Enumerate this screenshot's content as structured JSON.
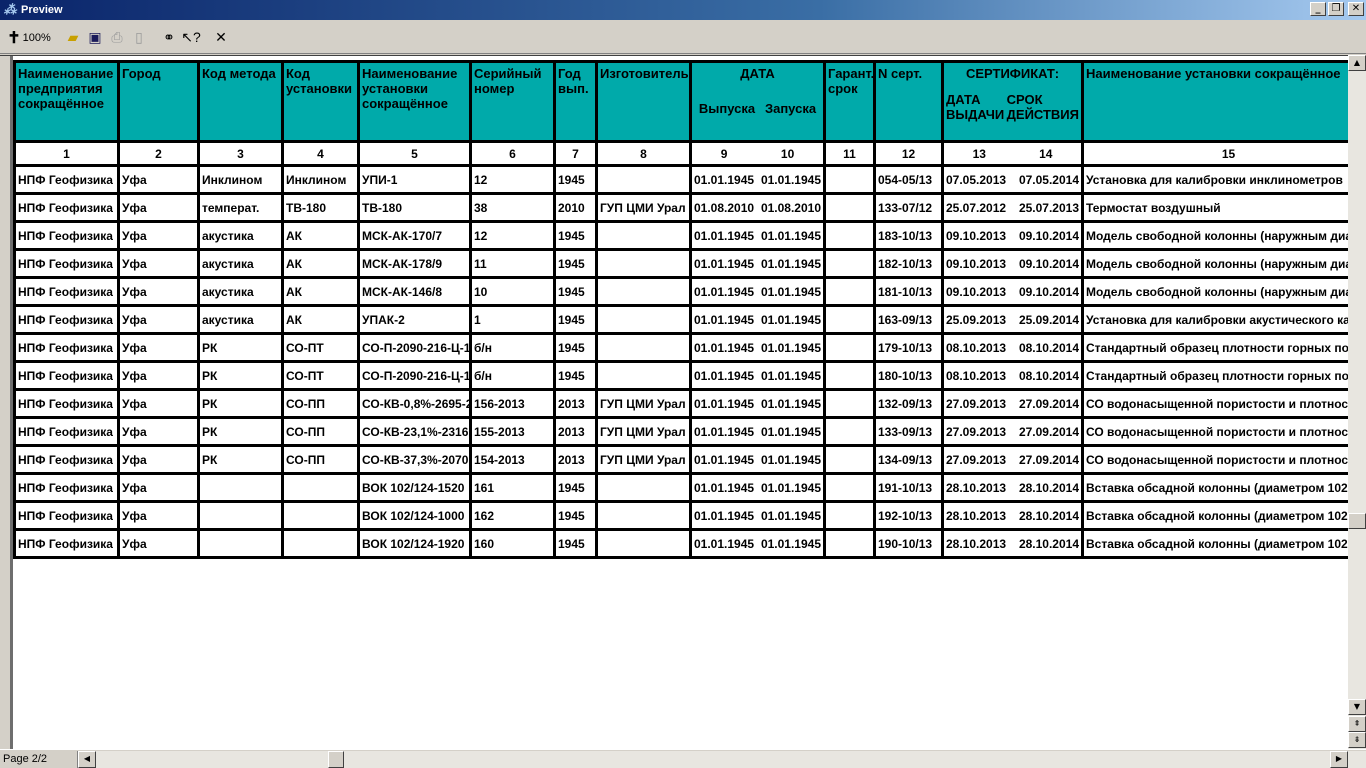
{
  "window": {
    "title": "Preview",
    "minimize_glyph": "_",
    "restore_glyph": "❐",
    "close_glyph": "✕"
  },
  "toolbar": {
    "zoom_label": "100%",
    "buttons": [
      "zoom-icon",
      "open-icon",
      "save-icon",
      "print-icon",
      "page-setup-icon",
      "find-icon",
      "help-icon",
      "close-icon"
    ]
  },
  "table": {
    "headers": {
      "c1": "Наименование предприятия сокращённое",
      "c2": "Город",
      "c3": "Код метода",
      "c4": "Код установки",
      "c5": "Наименование установки сокращённое",
      "c6": "Серийный номер",
      "c7": "Год вып.",
      "c8": "Изготовитель",
      "c9_10": "ДАТА",
      "c9": "Выпуска",
      "c10": "Запуска",
      "c11": "Гарант. срок",
      "c12": "N серт.",
      "c13_14": "СЕРТИФИКАТ:",
      "c13": "ДАТА ВЫДАЧИ",
      "c14": "СРОК ДЕЙСТВИЯ",
      "c15": "Наименование установки сокращённое"
    },
    "numbers": [
      "1",
      "2",
      "3",
      "4",
      "5",
      "6",
      "7",
      "8",
      "9",
      "10",
      "11",
      "12",
      "13",
      "14",
      "15"
    ],
    "rows": [
      [
        "НПФ Геофизика",
        "Уфа",
        "Инклином",
        "Инклином",
        "УПИ-1",
        "12",
        "1945",
        "",
        "01.01.1945",
        "01.01.1945",
        "",
        "054-05/13",
        "07.05.2013",
        "07.05.2014",
        "Установка для калибровки инклинометров"
      ],
      [
        "НПФ Геофизика",
        "Уфа",
        "температ.",
        "ТВ-180",
        "ТВ-180",
        "38",
        "2010",
        "ГУП ЦМИ Урал",
        "01.08.2010",
        "01.08.2010",
        "",
        "133-07/12",
        "25.07.2012",
        "25.07.2013",
        "Термостат воздушный"
      ],
      [
        "НПФ Геофизика",
        "Уфа",
        "акустика",
        "АК",
        "МСК-АК-170/7",
        "12",
        "1945",
        "",
        "01.01.1945",
        "01.01.1945",
        "",
        "183-10/13",
        "09.10.2013",
        "09.10.2014",
        "Модель свободной колонны (наружным диа"
      ],
      [
        "НПФ Геофизика",
        "Уфа",
        "акустика",
        "АК",
        "МСК-АК-178/9",
        "11",
        "1945",
        "",
        "01.01.1945",
        "01.01.1945",
        "",
        "182-10/13",
        "09.10.2013",
        "09.10.2014",
        "Модель свободной колонны (наружным диа"
      ],
      [
        "НПФ Геофизика",
        "Уфа",
        "акустика",
        "АК",
        "МСК-АК-146/8",
        "10",
        "1945",
        "",
        "01.01.1945",
        "01.01.1945",
        "",
        "181-10/13",
        "09.10.2013",
        "09.10.2014",
        "Модель свободной колонны (наружным диа"
      ],
      [
        "НПФ Геофизика",
        "Уфа",
        "акустика",
        "АК",
        "УПАК-2",
        "1",
        "1945",
        "",
        "01.01.1945",
        "01.01.1945",
        "",
        "163-09/13",
        "25.09.2013",
        "25.09.2014",
        "Установка для калибровки акустического ка"
      ],
      [
        "НПФ Геофизика",
        "Уфа",
        "РК",
        "СО-ПТ",
        "СО-П-2090-216-Ц-1",
        "б/н",
        "1945",
        "",
        "01.01.1945",
        "01.01.1945",
        "",
        "179-10/13",
        "08.10.2013",
        "08.10.2014",
        "Стандартный образец плотности горных пор"
      ],
      [
        "НПФ Геофизика",
        "Уфа",
        "РК",
        "СО-ПТ",
        "СО-П-2090-216-Ц-1",
        "б/н",
        "1945",
        "",
        "01.01.1945",
        "01.01.1945",
        "",
        "180-10/13",
        "08.10.2013",
        "08.10.2014",
        "Стандартный образец плотности горных пор"
      ],
      [
        "НПФ Геофизика",
        "Уфа",
        "РК",
        "СО-ПП",
        "СО-КВ-0,8%-2695-2",
        "156-2013",
        "2013",
        "ГУП ЦМИ Урал",
        "01.01.1945",
        "01.01.1945",
        "",
        "132-09/13",
        "27.09.2013",
        "27.09.2014",
        "СО водонасыщенной пористости и плотност"
      ],
      [
        "НПФ Геофизика",
        "Уфа",
        "РК",
        "СО-ПП",
        "СО-КВ-23,1%-2316",
        "155-2013",
        "2013",
        "ГУП ЦМИ Урал",
        "01.01.1945",
        "01.01.1945",
        "",
        "133-09/13",
        "27.09.2013",
        "27.09.2014",
        "СО водонасыщенной пористости и плотност"
      ],
      [
        "НПФ Геофизика",
        "Уфа",
        "РК",
        "СО-ПП",
        "СО-КВ-37,3%-2070",
        "154-2013",
        "2013",
        "ГУП ЦМИ Урал",
        "01.01.1945",
        "01.01.1945",
        "",
        "134-09/13",
        "27.09.2013",
        "27.09.2014",
        "СО водонасыщенной пористости и плотност"
      ],
      [
        "НПФ Геофизика",
        "Уфа",
        "",
        "",
        "ВОК 102/124-1520",
        "161",
        "1945",
        "",
        "01.01.1945",
        "01.01.1945",
        "",
        "191-10/13",
        "28.10.2013",
        "28.10.2014",
        "Вставка обсадной колонны (диаметром 102"
      ],
      [
        "НПФ Геофизика",
        "Уфа",
        "",
        "",
        "ВОК 102/124-1000",
        "162",
        "1945",
        "",
        "01.01.1945",
        "01.01.1945",
        "",
        "192-10/13",
        "28.10.2013",
        "28.10.2014",
        "Вставка обсадной колонны (диаметром 102"
      ],
      [
        "НПФ Геофизика",
        "Уфа",
        "",
        "",
        "ВОК 102/124-1920",
        "160",
        "1945",
        "",
        "01.01.1945",
        "01.01.1945",
        "",
        "190-10/13",
        "28.10.2013",
        "28.10.2014",
        "Вставка обсадной колонны (диаметром 102"
      ]
    ]
  },
  "status": {
    "page": "Page 2/2"
  },
  "colors": {
    "header_bg": "#00aaaa",
    "title_start": "#0a246a",
    "title_end": "#a6caf0"
  }
}
